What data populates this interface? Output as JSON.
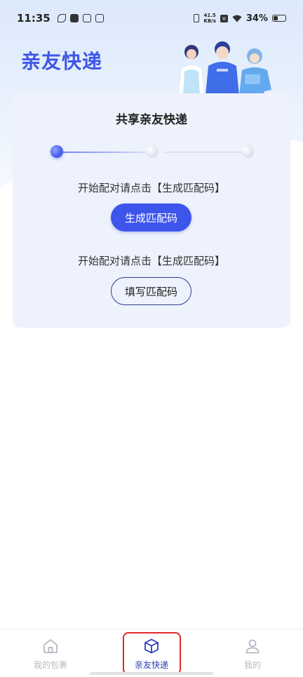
{
  "status_bar": {
    "time": "11:35",
    "net_speed_value": "41.5",
    "net_speed_unit": "KB/s",
    "battery_percent": "34%",
    "battery_level": 0.34
  },
  "header": {
    "title": "亲友快递"
  },
  "card": {
    "title": "共享亲友快递",
    "steps": {
      "total": 3,
      "current": 1
    },
    "hint_generate": "开始配对请点击【生成匹配码】",
    "generate_button": "生成匹配码",
    "hint_fill": "开始配对请点击【生成匹配码】",
    "fill_button": "填写匹配码"
  },
  "tabbar": {
    "items": [
      {
        "label": "我的包裹",
        "icon": "home-icon",
        "active": false
      },
      {
        "label": "亲友快递",
        "icon": "package-box-icon",
        "active": true
      },
      {
        "label": "我的",
        "icon": "user-icon",
        "active": false
      }
    ]
  },
  "colors": {
    "accent": "#3e55ec",
    "title": "#3f56e6",
    "highlight": "#e02828"
  }
}
